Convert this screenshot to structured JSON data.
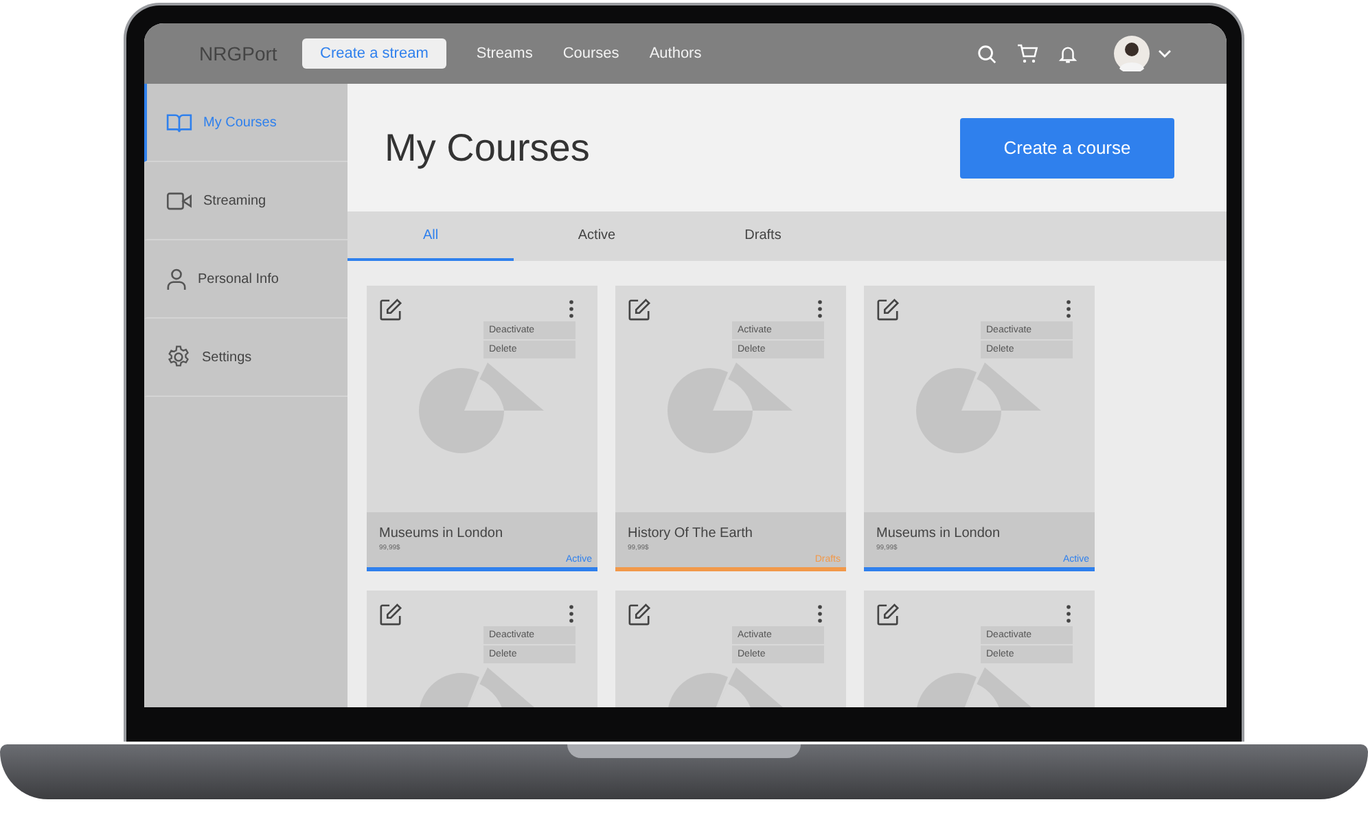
{
  "header": {
    "logo": "NRGPort",
    "create_button": "Create a stream",
    "nav": [
      "Streams",
      "Courses",
      "Authors"
    ]
  },
  "sidebar": {
    "items": [
      {
        "label": "My Courses",
        "kind": "book",
        "selected": true
      },
      {
        "label": "Streaming",
        "kind": "video",
        "selected": false
      },
      {
        "label": "Personal Info",
        "kind": "person",
        "selected": false
      },
      {
        "label": "Settings",
        "kind": "gear",
        "selected": false
      }
    ]
  },
  "page": {
    "title": "My Courses",
    "action_button": "Create a course"
  },
  "tabs": [
    {
      "label": "All",
      "selected": true
    },
    {
      "label": "Active",
      "selected": false
    },
    {
      "label": "Drafts",
      "selected": false
    }
  ],
  "cards": [
    {
      "title": "Museums in London",
      "price": "99,99$",
      "status": "Active",
      "color": "#2f80ed",
      "menu": [
        "Deactivate",
        "Delete"
      ]
    },
    {
      "title": "History Of The Earth",
      "price": "99,99$",
      "status": "Drafts",
      "color": "#f2994a",
      "menu": [
        "Activate",
        "Delete"
      ]
    },
    {
      "title": "Museums in London",
      "price": "99,99$",
      "status": "Active",
      "color": "#2f80ed",
      "menu": [
        "Deactivate",
        "Delete"
      ]
    },
    {
      "menu": [
        "Deactivate",
        "Delete"
      ]
    },
    {
      "menu": [
        "Activate",
        "Delete"
      ]
    },
    {
      "menu": [
        "Deactivate",
        "Delete"
      ]
    }
  ]
}
